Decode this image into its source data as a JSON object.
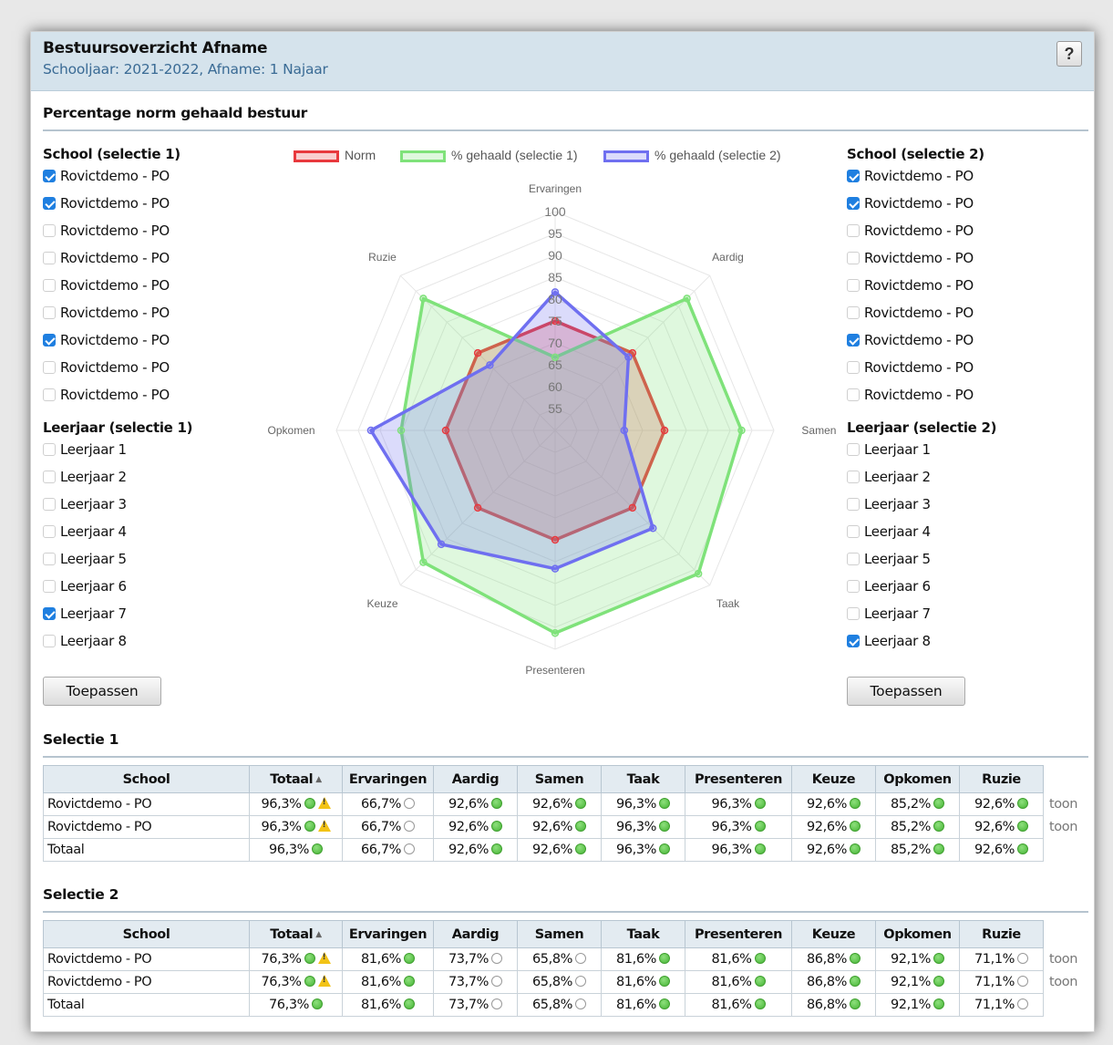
{
  "header": {
    "title": "Bestuursoverzicht Afname",
    "subtitle": "Schooljaar: 2021-2022, Afname: 1 Najaar",
    "help_label": "?"
  },
  "section_title": "Percentage norm gehaald bestuur",
  "left": {
    "school_title": "School (selectie 1)",
    "schools": [
      {
        "label": "Rovictdemo - PO",
        "checked": true
      },
      {
        "label": "Rovictdemo - PO",
        "checked": true
      },
      {
        "label": "Rovictdemo - PO",
        "checked": false
      },
      {
        "label": "Rovictdemo - PO",
        "checked": false
      },
      {
        "label": "Rovictdemo - PO",
        "checked": false
      },
      {
        "label": "Rovictdemo - PO",
        "checked": false
      },
      {
        "label": "Rovictdemo - PO",
        "checked": true
      },
      {
        "label": "Rovictdemo - PO",
        "checked": false
      },
      {
        "label": "Rovictdemo - PO",
        "checked": false
      }
    ],
    "grade_title": "Leerjaar (selectie 1)",
    "grades": [
      {
        "label": "Leerjaar 1",
        "checked": false
      },
      {
        "label": "Leerjaar 2",
        "checked": false
      },
      {
        "label": "Leerjaar 3",
        "checked": false
      },
      {
        "label": "Leerjaar 4",
        "checked": false
      },
      {
        "label": "Leerjaar 5",
        "checked": false
      },
      {
        "label": "Leerjaar 6",
        "checked": false
      },
      {
        "label": "Leerjaar 7",
        "checked": true
      },
      {
        "label": "Leerjaar 8",
        "checked": false
      }
    ],
    "apply_label": "Toepassen"
  },
  "right": {
    "school_title": "School (selectie 2)",
    "schools": [
      {
        "label": "Rovictdemo - PO",
        "checked": true
      },
      {
        "label": "Rovictdemo - PO",
        "checked": true
      },
      {
        "label": "Rovictdemo - PO",
        "checked": false
      },
      {
        "label": "Rovictdemo - PO",
        "checked": false
      },
      {
        "label": "Rovictdemo - PO",
        "checked": false
      },
      {
        "label": "Rovictdemo - PO",
        "checked": false
      },
      {
        "label": "Rovictdemo - PO",
        "checked": true
      },
      {
        "label": "Rovictdemo - PO",
        "checked": false
      },
      {
        "label": "Rovictdemo - PO",
        "checked": false
      }
    ],
    "grade_title": "Leerjaar (selectie 2)",
    "grades": [
      {
        "label": "Leerjaar 1",
        "checked": false
      },
      {
        "label": "Leerjaar 2",
        "checked": false
      },
      {
        "label": "Leerjaar 3",
        "checked": false
      },
      {
        "label": "Leerjaar 4",
        "checked": false
      },
      {
        "label": "Leerjaar 5",
        "checked": false
      },
      {
        "label": "Leerjaar 6",
        "checked": false
      },
      {
        "label": "Leerjaar 7",
        "checked": false
      },
      {
        "label": "Leerjaar 8",
        "checked": true
      }
    ],
    "apply_label": "Toepassen"
  },
  "chart_data": {
    "type": "radar",
    "categories": [
      "Ervaringen",
      "Aardig",
      "Samen",
      "Taak",
      "Presenteren",
      "Keuze",
      "Opkomen",
      "Ruzie"
    ],
    "r_ticks": [
      55,
      60,
      65,
      70,
      75,
      80,
      85,
      90,
      95,
      100
    ],
    "r_range": [
      50,
      100
    ],
    "grid": true,
    "legend_position": "top",
    "series": [
      {
        "name": "Norm",
        "color": "#e8383d",
        "fill": "rgba(232,56,61,0.25)",
        "values": [
          75,
          75,
          75,
          75,
          75,
          75,
          75,
          75
        ]
      },
      {
        "name": "% gehaald (selectie 1)",
        "color": "#7fe27a",
        "fill": "rgba(127,226,122,0.25)",
        "values": [
          66.7,
          92.6,
          92.6,
          96.3,
          96.3,
          92.6,
          85.2,
          92.6
        ]
      },
      {
        "name": "% gehaald (selectie 2)",
        "color": "#6f6ff0",
        "fill": "rgba(111,111,240,0.25)",
        "values": [
          81.6,
          73.7,
          65.8,
          81.6,
          81.6,
          86.8,
          92.1,
          71.1
        ]
      }
    ]
  },
  "tables": [
    {
      "title": "Selectie 1",
      "headers": [
        "School",
        "Totaal",
        "Ervaringen",
        "Aardig",
        "Samen",
        "Taak",
        "Presenteren",
        "Keuze",
        "Opkomen",
        "Ruzie"
      ],
      "sort_indicator": "▲",
      "rows": [
        {
          "school": "Rovictdemo - PO",
          "cells": [
            [
              "96,3%",
              "g"
            ],
            [
              "66,7%",
              "w"
            ],
            [
              "92,6%",
              "g"
            ],
            [
              "92,6%",
              "g"
            ],
            [
              "96,3%",
              "g"
            ],
            [
              "96,3%",
              "g"
            ],
            [
              "92,6%",
              "g"
            ],
            [
              "85,2%",
              "g"
            ],
            [
              "92,6%",
              "g"
            ]
          ],
          "warning": true,
          "action": "toon"
        },
        {
          "school": "Rovictdemo - PO",
          "cells": [
            [
              "96,3%",
              "g"
            ],
            [
              "66,7%",
              "w"
            ],
            [
              "92,6%",
              "g"
            ],
            [
              "92,6%",
              "g"
            ],
            [
              "96,3%",
              "g"
            ],
            [
              "96,3%",
              "g"
            ],
            [
              "92,6%",
              "g"
            ],
            [
              "85,2%",
              "g"
            ],
            [
              "92,6%",
              "g"
            ]
          ],
          "warning": true,
          "action": "toon"
        },
        {
          "school": "Totaal",
          "cells": [
            [
              "96,3%",
              "g"
            ],
            [
              "66,7%",
              "w"
            ],
            [
              "92,6%",
              "g"
            ],
            [
              "92,6%",
              "g"
            ],
            [
              "96,3%",
              "g"
            ],
            [
              "96,3%",
              "g"
            ],
            [
              "92,6%",
              "g"
            ],
            [
              "85,2%",
              "g"
            ],
            [
              "92,6%",
              "g"
            ]
          ],
          "warning": false,
          "action": ""
        }
      ]
    },
    {
      "title": "Selectie 2",
      "headers": [
        "School",
        "Totaal",
        "Ervaringen",
        "Aardig",
        "Samen",
        "Taak",
        "Presenteren",
        "Keuze",
        "Opkomen",
        "Ruzie"
      ],
      "sort_indicator": "▲",
      "rows": [
        {
          "school": "Rovictdemo - PO",
          "cells": [
            [
              "76,3%",
              "g"
            ],
            [
              "81,6%",
              "g"
            ],
            [
              "73,7%",
              "w"
            ],
            [
              "65,8%",
              "w"
            ],
            [
              "81,6%",
              "g"
            ],
            [
              "81,6%",
              "g"
            ],
            [
              "86,8%",
              "g"
            ],
            [
              "92,1%",
              "g"
            ],
            [
              "71,1%",
              "w"
            ]
          ],
          "warning": true,
          "action": "toon"
        },
        {
          "school": "Rovictdemo - PO",
          "cells": [
            [
              "76,3%",
              "g"
            ],
            [
              "81,6%",
              "g"
            ],
            [
              "73,7%",
              "w"
            ],
            [
              "65,8%",
              "w"
            ],
            [
              "81,6%",
              "g"
            ],
            [
              "81,6%",
              "g"
            ],
            [
              "86,8%",
              "g"
            ],
            [
              "92,1%",
              "g"
            ],
            [
              "71,1%",
              "w"
            ]
          ],
          "warning": true,
          "action": "toon"
        },
        {
          "school": "Totaal",
          "cells": [
            [
              "76,3%",
              "g"
            ],
            [
              "81,6%",
              "g"
            ],
            [
              "73,7%",
              "w"
            ],
            [
              "65,8%",
              "w"
            ],
            [
              "81,6%",
              "g"
            ],
            [
              "81,6%",
              "g"
            ],
            [
              "86,8%",
              "g"
            ],
            [
              "92,1%",
              "g"
            ],
            [
              "71,1%",
              "w"
            ]
          ],
          "warning": false,
          "action": ""
        }
      ]
    }
  ]
}
